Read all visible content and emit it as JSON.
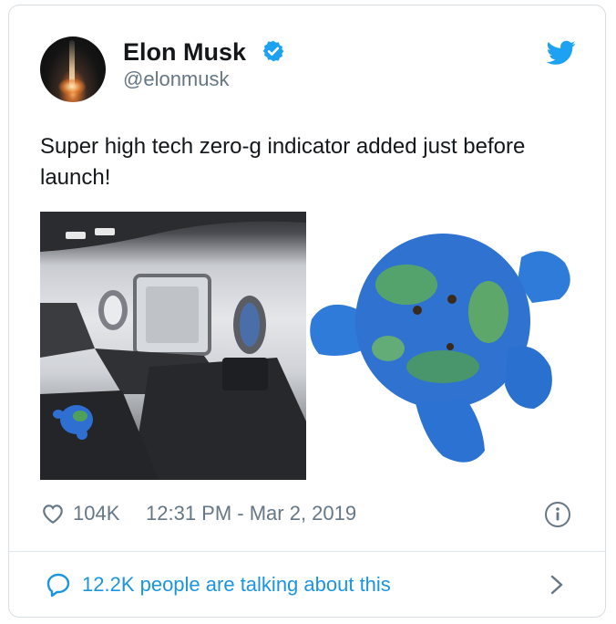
{
  "author": {
    "name": "Elon Musk",
    "handle": "@elonmusk",
    "avatar_icon": "rocket-launch-avatar",
    "verified": true
  },
  "platform_icon": "twitter-bird-icon",
  "tweet": {
    "text": "Super high tech zero-g indicator added just before launch!"
  },
  "media": [
    {
      "description_icon": "spacecraft-cabin-photo"
    },
    {
      "description_icon": "earth-plush-toy-photo"
    }
  ],
  "footer": {
    "likes": "104K",
    "timestamp": "12:31 PM - Mar 2, 2019",
    "talking": "12.2K people are talking about this"
  },
  "colors": {
    "accent": "#1b95e0",
    "secondary_text": "#657786",
    "twitter_blue": "#1da1f2"
  }
}
